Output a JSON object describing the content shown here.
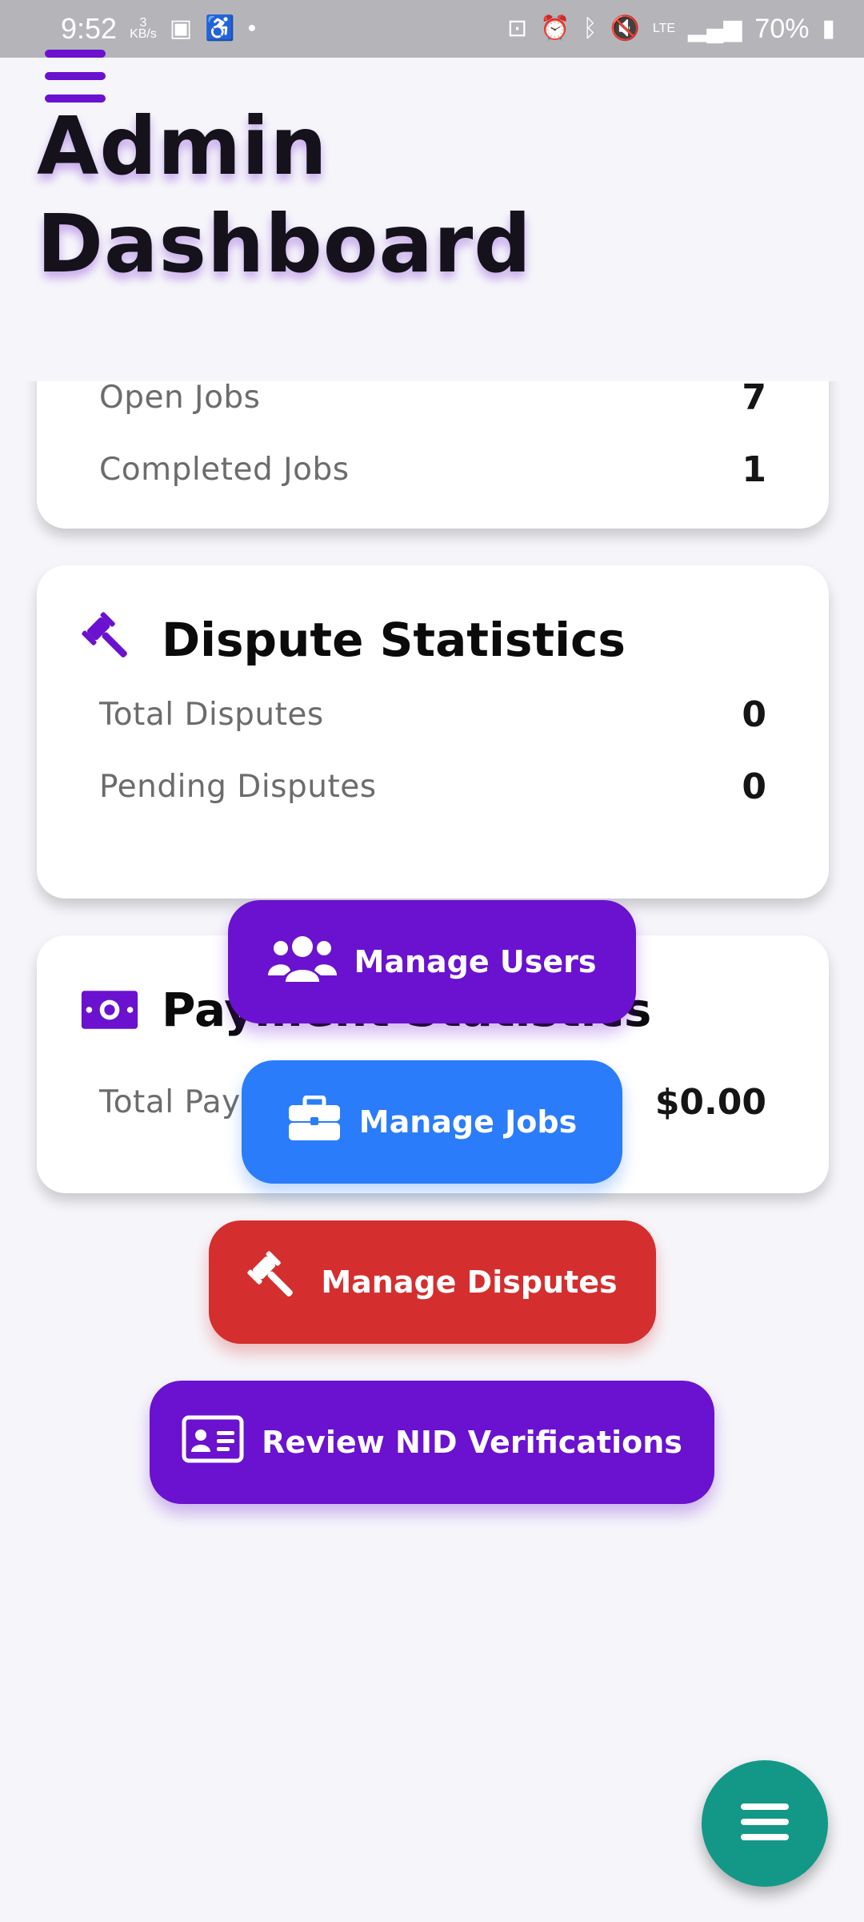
{
  "status_bar": {
    "time": "9:52",
    "net_speed_value": "3",
    "net_speed_unit": "KB/s",
    "network": "LTE",
    "battery": "70%"
  },
  "header": {
    "title": "Admin Dashboard"
  },
  "job_card": {
    "rows": [
      {
        "label": "Open Jobs",
        "value": "7"
      },
      {
        "label": "Completed Jobs",
        "value": "1"
      }
    ]
  },
  "dispute_card": {
    "title": "Dispute Statistics",
    "icon": "gavel-icon",
    "rows": [
      {
        "label": "Total Disputes",
        "value": "0"
      },
      {
        "label": "Pending Disputes",
        "value": "0"
      }
    ]
  },
  "payment_card": {
    "title": "Payment Statistics",
    "icon": "money-bill-icon",
    "rows": [
      {
        "label": "Total Payments Processed",
        "value": "$0.00"
      }
    ]
  },
  "actions": [
    {
      "label": "Manage Users",
      "icon": "users-icon",
      "color": "#6a12cf"
    },
    {
      "label": "Manage Jobs",
      "icon": "briefcase-icon",
      "color": "#2a7cfa"
    },
    {
      "label": "Manage Disputes",
      "icon": "gavel-icon",
      "color": "#d42e2e"
    },
    {
      "label": "Review NID Verifications",
      "icon": "id-card-icon",
      "color": "#6a12cf"
    }
  ],
  "colors": {
    "accent": "#6a12cf",
    "fab": "#139888",
    "background": "#f6f6fa"
  }
}
